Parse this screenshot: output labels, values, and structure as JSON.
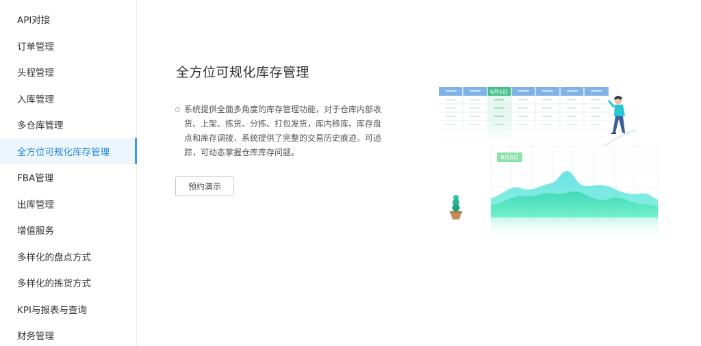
{
  "sidebar": {
    "items": [
      {
        "label": "API对接",
        "active": false
      },
      {
        "label": "订单管理",
        "active": false
      },
      {
        "label": "头程管理",
        "active": false
      },
      {
        "label": "入库管理",
        "active": false
      },
      {
        "label": "多仓库管理",
        "active": false
      },
      {
        "label": "全方位可规化库存管理",
        "active": true
      },
      {
        "label": "FBA管理",
        "active": false
      },
      {
        "label": "出库管理",
        "active": false
      },
      {
        "label": "增值服务",
        "active": false
      },
      {
        "label": "多样化的盘点方式",
        "active": false
      },
      {
        "label": "多样化的拣货方式",
        "active": false
      },
      {
        "label": "KPI与报表与查询",
        "active": false
      },
      {
        "label": "财务管理",
        "active": false
      }
    ]
  },
  "main": {
    "title": "全方位可规化库存管理",
    "description": "系统提供全面多角度的库存管理功能，对于仓库内部收货、上架、拣货、分拣、打包发货，库内移库、库存盘点和库存调拨，系统提供了完整的交易历史痕迹。可追踪，可动态掌握仓库库存问题。",
    "demo_button": "预约演示"
  },
  "illustration": {
    "calendar_date": "6月6日",
    "chart_date": "8月8日",
    "accent_color": "#3d9be0",
    "calendar_header_color": "#7fb3e8",
    "calendar_highlight_color": "#43c08c",
    "chart_fill_color": "#4fe1dc"
  }
}
